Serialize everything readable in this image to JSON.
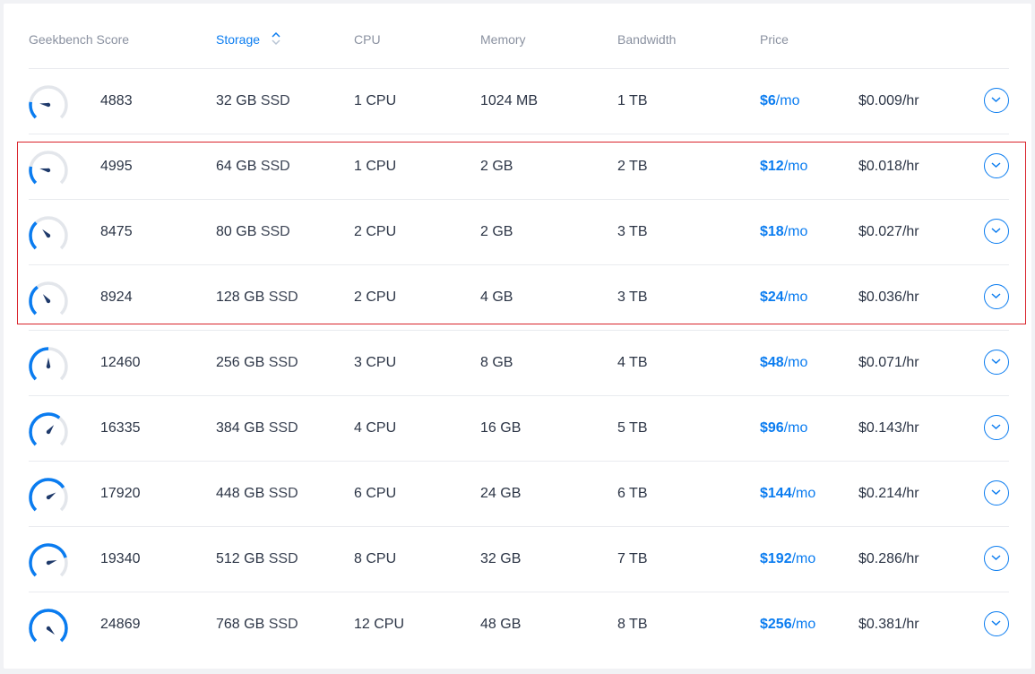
{
  "header": {
    "geekbench": "Geekbench Score",
    "storage": "Storage",
    "cpu": "CPU",
    "memory": "Memory",
    "bandwidth": "Bandwidth",
    "price": "Price"
  },
  "colors": {
    "accent": "#0a7cf0",
    "highlight": "#d9232b",
    "text": "#2b3445"
  },
  "icons": {
    "sort": "sort-up-down-icon",
    "expand": "chevron-down-circle-icon",
    "gauge": "speedometer-gauge-icon"
  },
  "rows": [
    {
      "score": "4883",
      "gauge_level": 0.2,
      "storage_size": "32 GB",
      "storage_type": "SSD",
      "cpu": "1 CPU",
      "memory": "1024 MB",
      "bandwidth": "1 TB",
      "price_amount": "$6",
      "price_unit": "/mo",
      "hourly": "$0.009/hr"
    },
    {
      "score": "4995",
      "gauge_level": 0.21,
      "storage_size": "64 GB",
      "storage_type": "SSD",
      "cpu": "1 CPU",
      "memory": "2 GB",
      "bandwidth": "2 TB",
      "price_amount": "$12",
      "price_unit": "/mo",
      "hourly": "$0.018/hr"
    },
    {
      "score": "8475",
      "gauge_level": 0.34,
      "storage_size": "80 GB",
      "storage_type": "SSD",
      "cpu": "2 CPU",
      "memory": "2 GB",
      "bandwidth": "3 TB",
      "price_amount": "$18",
      "price_unit": "/mo",
      "hourly": "$0.027/hr"
    },
    {
      "score": "8924",
      "gauge_level": 0.36,
      "storage_size": "128 GB",
      "storage_type": "SSD",
      "cpu": "2 CPU",
      "memory": "4 GB",
      "bandwidth": "3 TB",
      "price_amount": "$24",
      "price_unit": "/mo",
      "hourly": "$0.036/hr"
    },
    {
      "score": "12460",
      "gauge_level": 0.5,
      "storage_size": "256 GB",
      "storage_type": "SSD",
      "cpu": "3 CPU",
      "memory": "8 GB",
      "bandwidth": "4 TB",
      "price_amount": "$48",
      "price_unit": "/mo",
      "hourly": "$0.071/hr"
    },
    {
      "score": "16335",
      "gauge_level": 0.64,
      "storage_size": "384 GB",
      "storage_type": "SSD",
      "cpu": "4 CPU",
      "memory": "16 GB",
      "bandwidth": "5 TB",
      "price_amount": "$96",
      "price_unit": "/mo",
      "hourly": "$0.143/hr"
    },
    {
      "score": "17920",
      "gauge_level": 0.71,
      "storage_size": "448 GB",
      "storage_type": "SSD",
      "cpu": "6 CPU",
      "memory": "24 GB",
      "bandwidth": "6 TB",
      "price_amount": "$144",
      "price_unit": "/mo",
      "hourly": "$0.214/hr"
    },
    {
      "score": "19340",
      "gauge_level": 0.77,
      "storage_size": "512 GB",
      "storage_type": "SSD",
      "cpu": "8 CPU",
      "memory": "32 GB",
      "bandwidth": "7 TB",
      "price_amount": "$192",
      "price_unit": "/mo",
      "hourly": "$0.286/hr"
    },
    {
      "score": "24869",
      "gauge_level": 1.0,
      "storage_size": "768 GB",
      "storage_type": "SSD",
      "cpu": "12 CPU",
      "memory": "48 GB",
      "bandwidth": "8 TB",
      "price_amount": "$256",
      "price_unit": "/mo",
      "hourly": "$0.381/hr"
    }
  ]
}
